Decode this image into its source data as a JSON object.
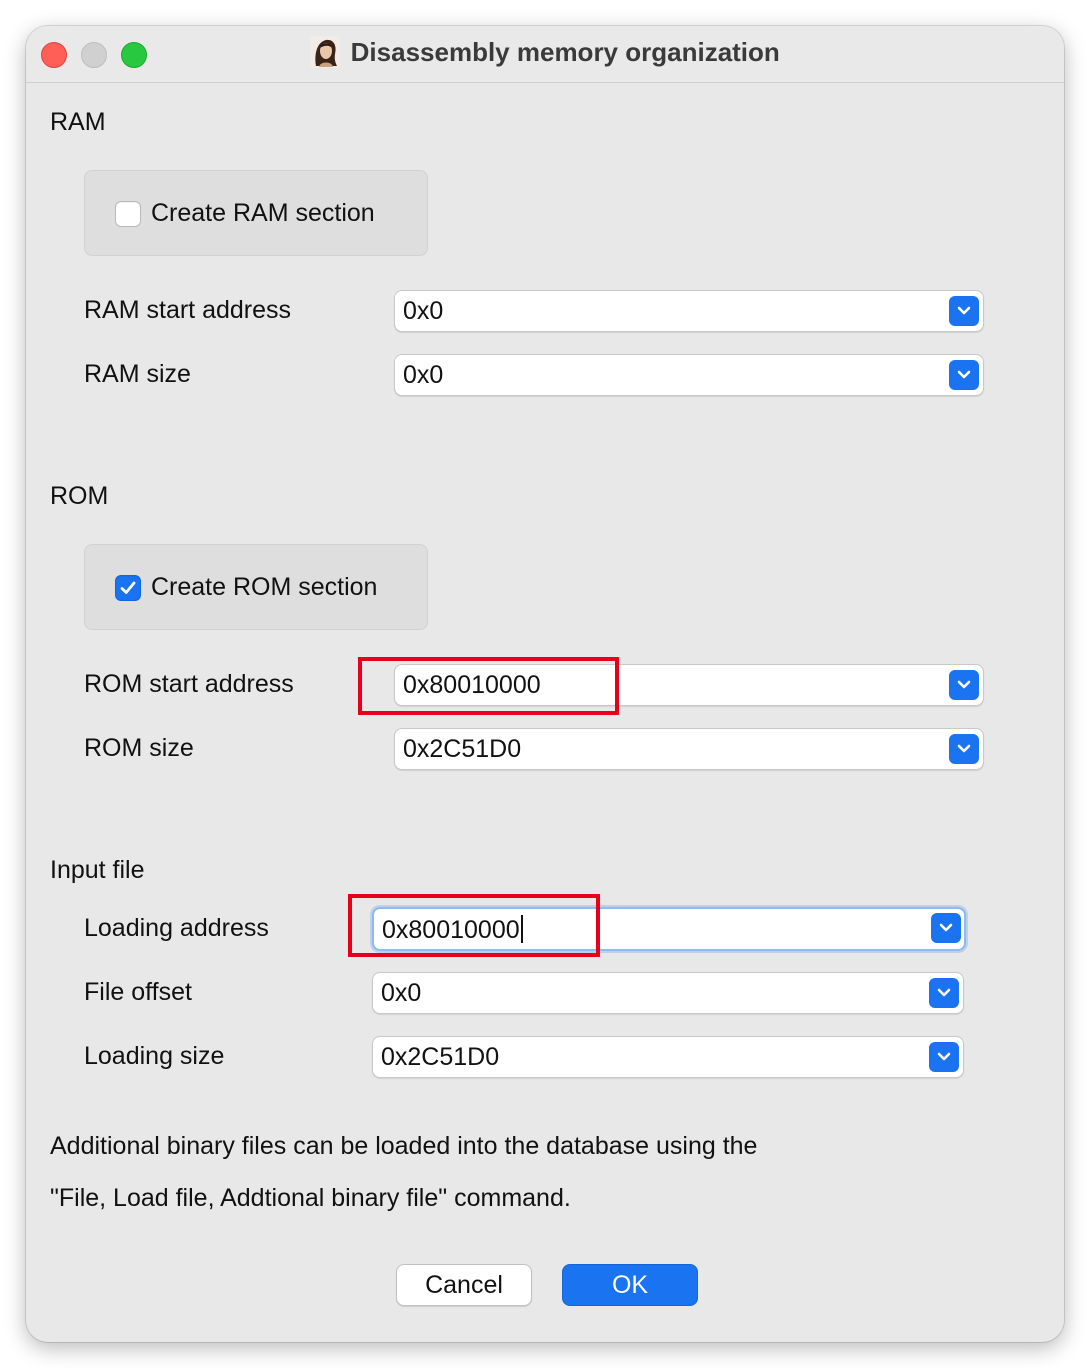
{
  "window": {
    "title": "Disassembly memory organization",
    "app_icon": "portrait-app-icon"
  },
  "ram": {
    "section_label": "RAM",
    "create_checkbox": {
      "label": "Create RAM section",
      "checked": false
    },
    "start_address": {
      "label": "RAM start address",
      "value": "0x0"
    },
    "size": {
      "label": "RAM size",
      "value": "0x0"
    }
  },
  "rom": {
    "section_label": "ROM",
    "create_checkbox": {
      "label": "Create ROM section",
      "checked": true
    },
    "start_address": {
      "label": "ROM start address",
      "value": "0x80010000",
      "highlighted": true
    },
    "size": {
      "label": "ROM size",
      "value": "0x2C51D0"
    }
  },
  "input_file": {
    "section_label": "Input file",
    "loading_address": {
      "label": "Loading address",
      "value": "0x80010000",
      "focused": true,
      "highlighted": true
    },
    "file_offset": {
      "label": "File offset",
      "value": "0x0"
    },
    "loading_size": {
      "label": "Loading size",
      "value": "0x2C51D0"
    }
  },
  "info": {
    "line1": "Additional binary files can be loaded into the database using the",
    "line2": "\"File, Load file, Addtional binary file\" command."
  },
  "buttons": {
    "cancel": "Cancel",
    "ok": "OK"
  },
  "colors": {
    "accent": "#1a73f0",
    "highlight": "#e8001a",
    "window_bg": "#e8e8e8"
  }
}
